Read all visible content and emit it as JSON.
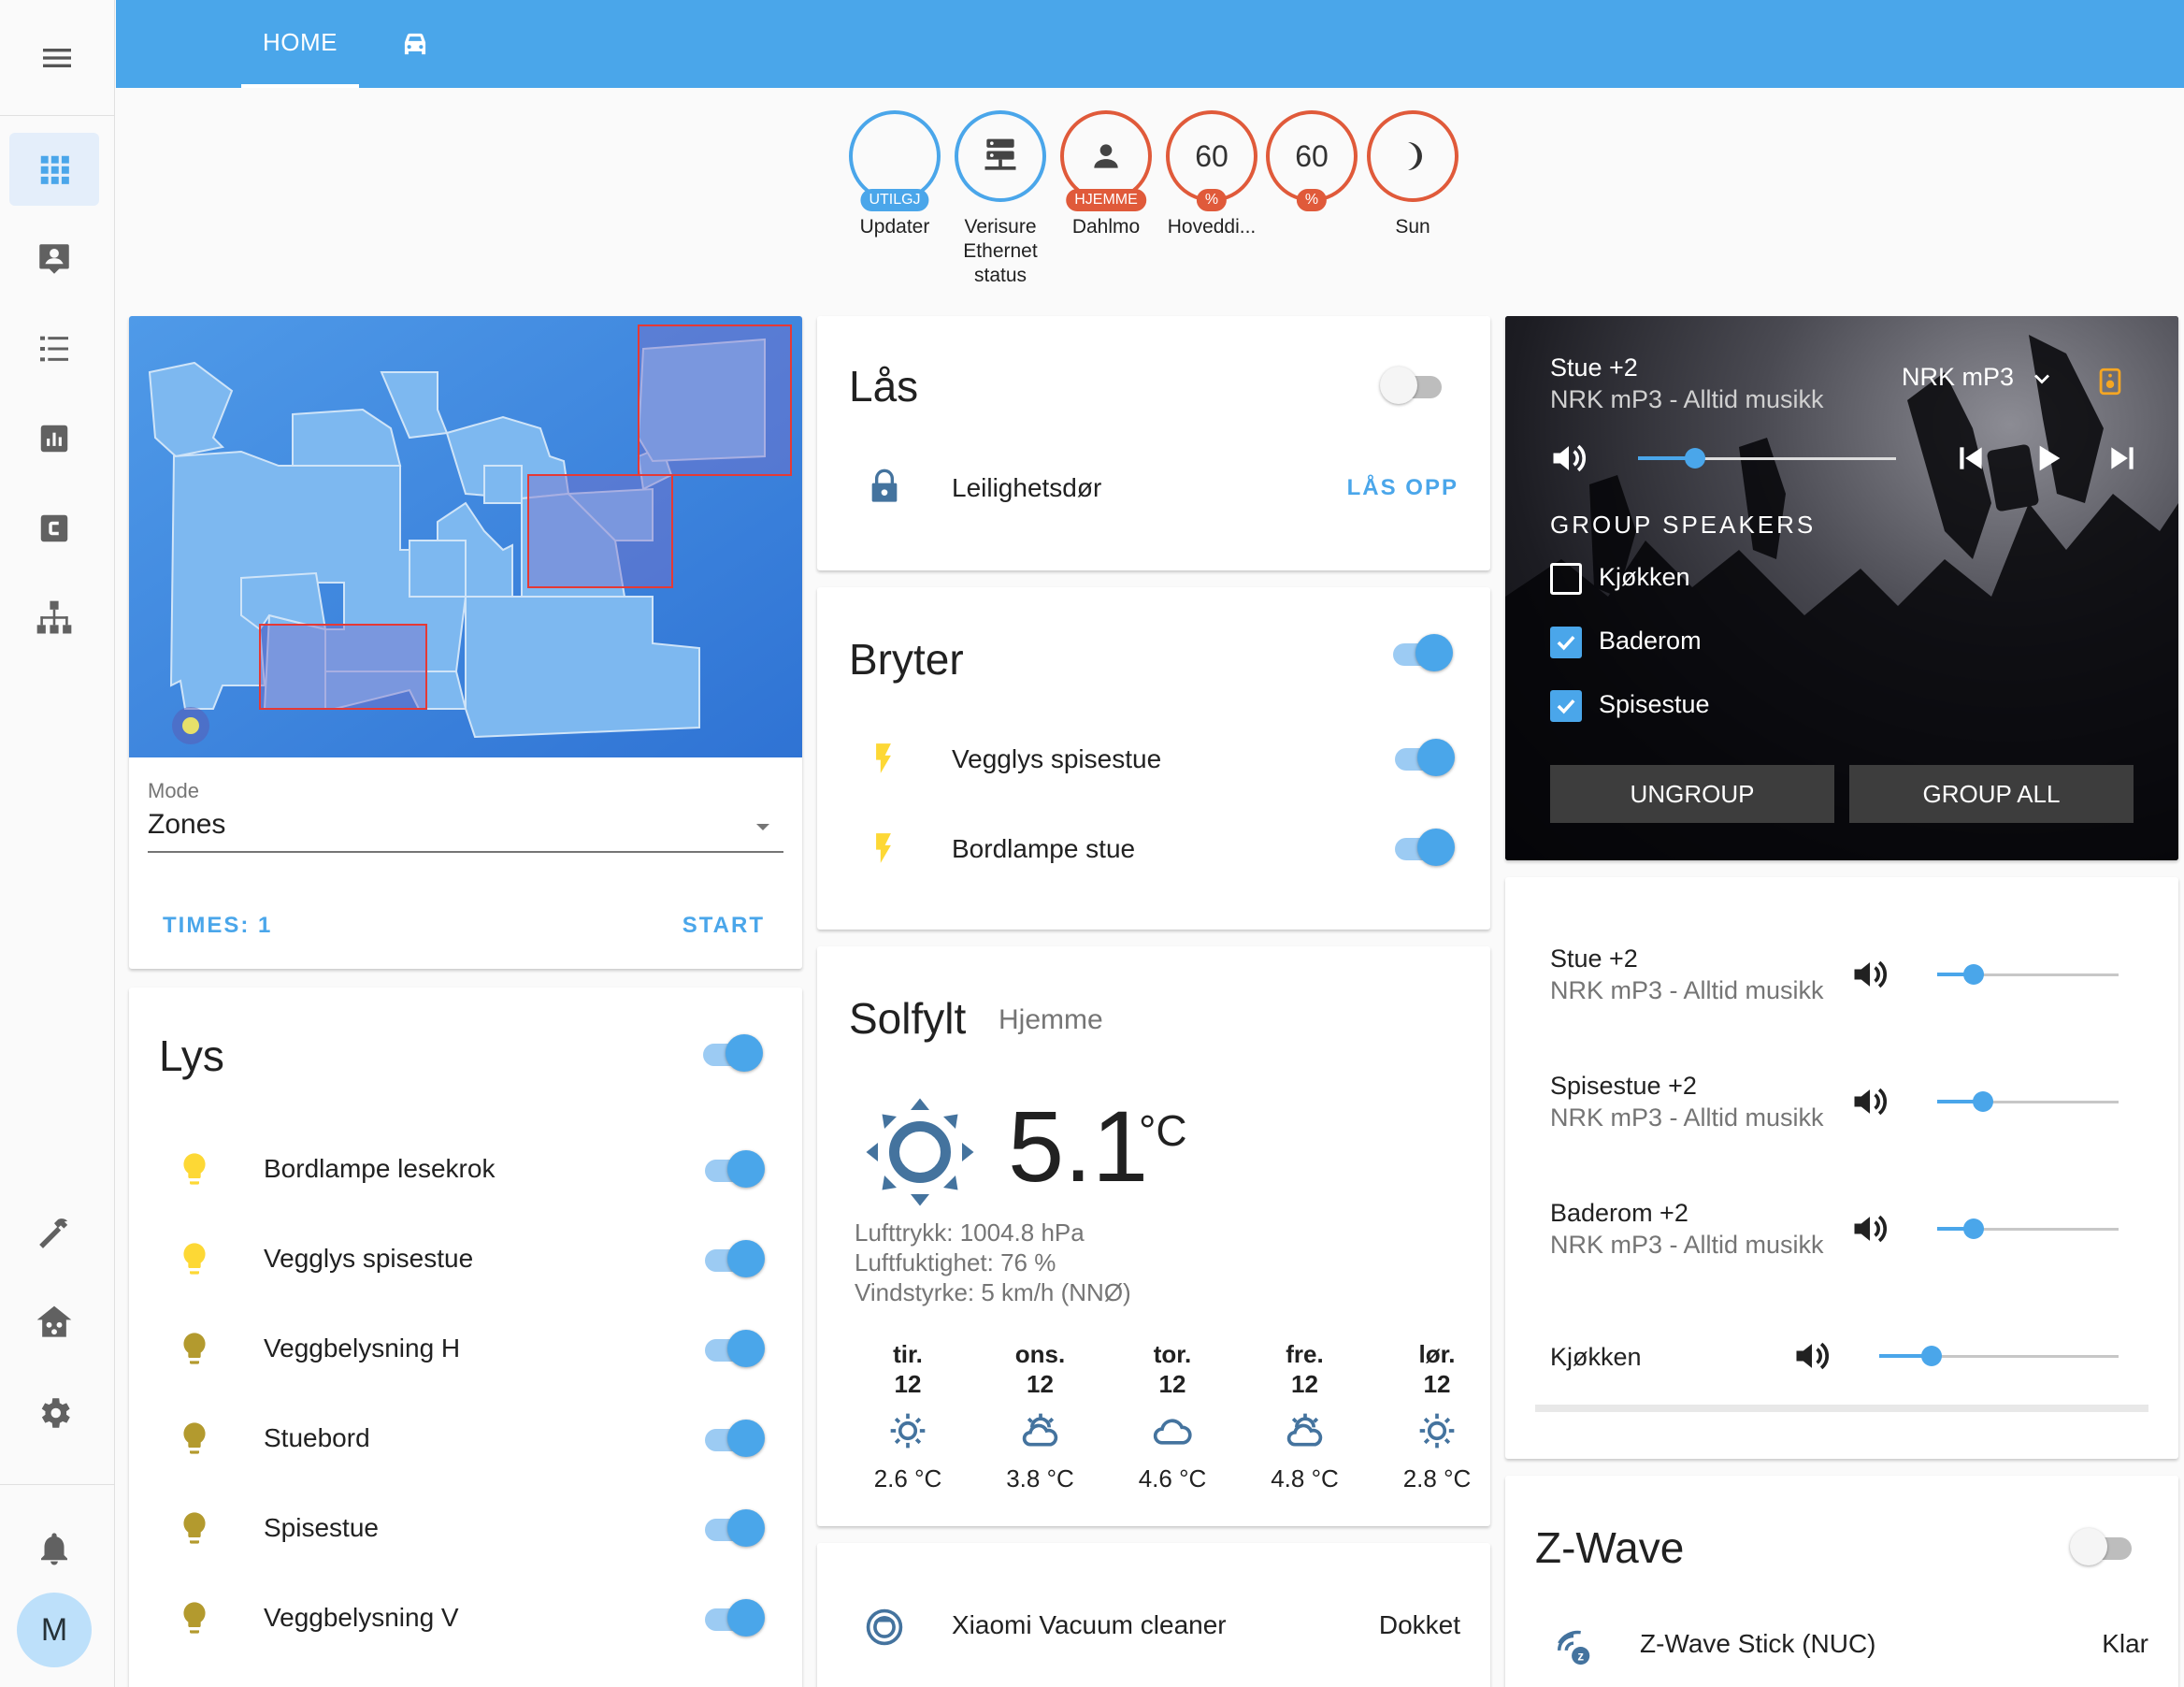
{
  "header": {
    "tabs": [
      {
        "label": "HOME"
      },
      {
        "icon": "car-icon"
      }
    ]
  },
  "sidebar": {
    "items": [
      {
        "icon": "grid-icon",
        "active": true
      },
      {
        "icon": "account-box-icon"
      },
      {
        "icon": "list-icon"
      },
      {
        "icon": "chart-icon"
      },
      {
        "icon": "calendar-c-icon"
      },
      {
        "icon": "sitemap-icon"
      }
    ],
    "tools": [
      {
        "icon": "hammer-icon"
      },
      {
        "icon": "home-network-icon"
      },
      {
        "icon": "gear-icon"
      }
    ],
    "avatar": "M"
  },
  "badges": [
    {
      "value": "",
      "unit": "UTILGJ",
      "label": "Updater"
    },
    {
      "icon": "server-network-icon",
      "label": "Verisure Ethernet status"
    },
    {
      "icon": "person-icon",
      "unit": "HJEMME",
      "label": "Dahlmo"
    },
    {
      "value": "60",
      "unit": "%",
      "label": "Hoveddi..."
    },
    {
      "value": "60",
      "unit": "%",
      "label": ""
    },
    {
      "icon": "moon-icon",
      "label": "Sun"
    }
  ],
  "vacuum_map": {
    "mode_label": "Mode",
    "mode_value": "Zones",
    "times_label": "TIMES: 1",
    "start_label": "START"
  },
  "lys": {
    "title": "Lys",
    "items": [
      {
        "name": "Bordlampe lesekrok",
        "color": "#fdd835"
      },
      {
        "name": "Vegglys spisestue",
        "color": "#fdd835"
      },
      {
        "name": "Veggbelysning H",
        "color": "#b39a2e"
      },
      {
        "name": "Stuebord",
        "color": "#b39a2e"
      },
      {
        "name": "Spisestue",
        "color": "#b39a2e"
      },
      {
        "name": "Veggbelysning V",
        "color": "#b39a2e"
      }
    ]
  },
  "las": {
    "title": "Lås",
    "item": "Leilighetsdør",
    "action": "LÅS OPP"
  },
  "bryter": {
    "title": "Bryter",
    "items": [
      {
        "name": "Vegglys spisestue"
      },
      {
        "name": "Bordlampe stue"
      }
    ]
  },
  "weather": {
    "title": "Solfylt",
    "location": "Hjemme",
    "temp": "5.1",
    "unit": "°C",
    "details": [
      "Lufttrykk: 1004.8 hPa",
      "Luftfuktighet: 76 %",
      "Vindstyrke: 5 km/h (NNØ)"
    ],
    "forecast": [
      {
        "day": "tir.",
        "date": "12",
        "icon": "sunny-icon",
        "temp": "2.6 °C"
      },
      {
        "day": "ons.",
        "date": "12",
        "icon": "partly-cloudy-icon",
        "temp": "3.8 °C"
      },
      {
        "day": "tor.",
        "date": "12",
        "icon": "cloudy-icon",
        "temp": "4.6 °C"
      },
      {
        "day": "fre.",
        "date": "12",
        "icon": "partly-cloudy-icon",
        "temp": "4.8 °C"
      },
      {
        "day": "lør.",
        "date": "12",
        "icon": "sunny-icon",
        "temp": "2.8 °C"
      }
    ]
  },
  "vacuum": {
    "name": "Xiaomi Vacuum cleaner",
    "state": "Dokket"
  },
  "media": {
    "title": "Stue +2",
    "subtitle": "NRK mP3 - Alltid musikk",
    "source": "NRK mP3",
    "volume": 0.22,
    "group_title": "GROUP SPEAKERS",
    "speakers": [
      {
        "name": "Kjøkken",
        "checked": false
      },
      {
        "name": "Baderom",
        "checked": true
      },
      {
        "name": "Spisestue",
        "checked": true
      }
    ],
    "ungroup_label": "UNGROUP",
    "group_all_label": "GROUP ALL"
  },
  "speakers_list": [
    {
      "name": "Stue +2",
      "sub": "NRK mP3 - Alltid musikk",
      "volume": 0.2
    },
    {
      "name": "Spisestue +2",
      "sub": "NRK mP3 - Alltid musikk",
      "volume": 0.25
    },
    {
      "name": "Baderom +2",
      "sub": "NRK mP3 - Alltid musikk",
      "volume": 0.2
    },
    {
      "name": "Kjøkken",
      "sub": "",
      "volume": 0.22
    }
  ],
  "zwave": {
    "title": "Z-Wave",
    "item": "Z-Wave Stick (NUC)",
    "state": "Klar"
  }
}
